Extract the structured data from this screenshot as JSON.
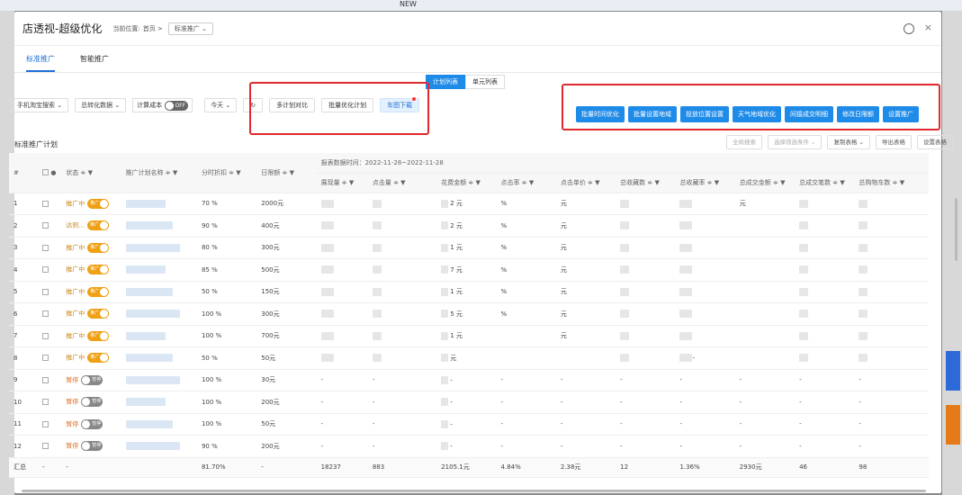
{
  "window": {
    "title": "店透视-超级优化",
    "breadcrumb_label": "当前位置:",
    "breadcrumb_home": "首页 >",
    "breadcrumb_current": "标准推广",
    "close": "×"
  },
  "background": {
    "new_badge": "NEW"
  },
  "tabs": [
    {
      "label": "标准推广"
    },
    {
      "label": "智能推广"
    }
  ],
  "view_toggle": {
    "plan_list": "计划列表",
    "unit_list": "单元列表"
  },
  "toolbar": {
    "device": "手机淘宝搜索",
    "data_type": "总转化数据",
    "cost_label": "计算成本",
    "cost_toggle": "OFF",
    "date": "今天",
    "refresh": "↻",
    "compare": "多计划对比",
    "batch_optimize": "批量优化计划",
    "car_download": "车图下载"
  },
  "batch_buttons": [
    "批量时间优化",
    "批量设置地域",
    "投放位置设置",
    "天气地域优化",
    "间接成交明细",
    "修改日限额",
    "设置推广"
  ],
  "section": {
    "title": "标准推广计划",
    "global_search": "全局搜索",
    "filter": "选择筛选条件",
    "copy_table": "复制表格",
    "export": "导出表格",
    "settings": "设置表格"
  },
  "table": {
    "report_range": "报表数据时间：2022-11-28~2022-11-28",
    "headers": [
      "#",
      "",
      "状态 ≑ ▼",
      "推广计划名称 ≑ ▼",
      "分时折扣 ≑ ▼",
      "日限额 ≑ ▼",
      "展现量 ≑ ▼",
      "点击量 ≑ ▼",
      "花费金额 ≑ ▼",
      "点击率 ≑ ▼",
      "点击单价 ≑ ▼",
      "总收藏数 ≑ ▼",
      "总收藏率 ≑ ▼",
      "总成交金额 ≑ ▼",
      "总成交笔数 ≑ ▼",
      "总购物车数 ≑ ▼"
    ],
    "rows": [
      {
        "n": "1",
        "status": "推广中",
        "on": true,
        "toggle": "推广",
        "discount": "70 %",
        "limit": "2000元",
        "cost": "2 元",
        "ctr": "%",
        "cpc": "元",
        "fav_rate": "",
        "amount": "元"
      },
      {
        "n": "2",
        "status": "达到...",
        "on": true,
        "toggle": "推广",
        "discount": "90 %",
        "limit": "400元",
        "cost": "2 元",
        "ctr": "%",
        "cpc": "元",
        "fav_rate": "",
        "amount": ""
      },
      {
        "n": "3",
        "status": "推广中",
        "on": true,
        "toggle": "推广",
        "discount": "80 %",
        "limit": "300元",
        "cost": "1 元",
        "ctr": "%",
        "cpc": "元",
        "fav_rate": "",
        "amount": ""
      },
      {
        "n": "4",
        "status": "推广中",
        "on": true,
        "toggle": "推广",
        "discount": "85 %",
        "limit": "500元",
        "cost": "7 元",
        "ctr": "%",
        "cpc": "元",
        "fav_rate": "",
        "amount": ""
      },
      {
        "n": "5",
        "status": "推广中",
        "on": true,
        "toggle": "推广",
        "discount": "50 %",
        "limit": "150元",
        "cost": "1 元",
        "ctr": "%",
        "cpc": "元",
        "fav_rate": "",
        "amount": ""
      },
      {
        "n": "6",
        "status": "推广中",
        "on": true,
        "toggle": "推广",
        "discount": "100 %",
        "limit": "300元",
        "cost": "5 元",
        "ctr": "%",
        "cpc": "元",
        "fav_rate": "",
        "amount": ""
      },
      {
        "n": "7",
        "status": "推广中",
        "on": true,
        "toggle": "推广",
        "discount": "100 %",
        "limit": "700元",
        "cost": "1 元",
        "ctr": "",
        "cpc": "元",
        "fav_rate": "",
        "amount": ""
      },
      {
        "n": "8",
        "status": "推广中",
        "on": true,
        "toggle": "推广",
        "discount": "50 %",
        "limit": "50元",
        "cost": "元",
        "ctr": "",
        "cpc": "",
        "fav_rate": "-",
        "amount": ""
      },
      {
        "n": "9",
        "status": "暂停",
        "on": false,
        "toggle": "暂停",
        "discount": "100 %",
        "limit": "30元",
        "cost": "-",
        "ctr": "-",
        "cpc": "-",
        "fav_rate": "-",
        "amount": "-"
      },
      {
        "n": "10",
        "status": "暂停",
        "on": false,
        "toggle": "暂停",
        "discount": "100 %",
        "limit": "200元",
        "cost": "-",
        "ctr": "-",
        "cpc": "-",
        "fav_rate": "-",
        "amount": "-"
      },
      {
        "n": "11",
        "status": "暂停",
        "on": false,
        "toggle": "暂停",
        "discount": "100 %",
        "limit": "50元",
        "cost": "-",
        "ctr": "-",
        "cpc": "-",
        "fav_rate": "-",
        "amount": "-"
      },
      {
        "n": "12",
        "status": "暂停",
        "on": false,
        "toggle": "暂停",
        "discount": "90 %",
        "limit": "200元",
        "cost": "-",
        "ctr": "-",
        "cpc": "-",
        "fav_rate": "-",
        "amount": "-"
      }
    ],
    "totals": [
      "汇总",
      "-",
      "-",
      "",
      "81.70%",
      "-",
      "18237",
      "883",
      "2105.1元",
      "4.84%",
      "2.38元",
      "12",
      "1.36%",
      "2930元",
      "46",
      "98"
    ]
  },
  "colors": {
    "accent": "#1f8be8",
    "highlight": "#e0292c",
    "toggle_on": "#f0a013"
  }
}
